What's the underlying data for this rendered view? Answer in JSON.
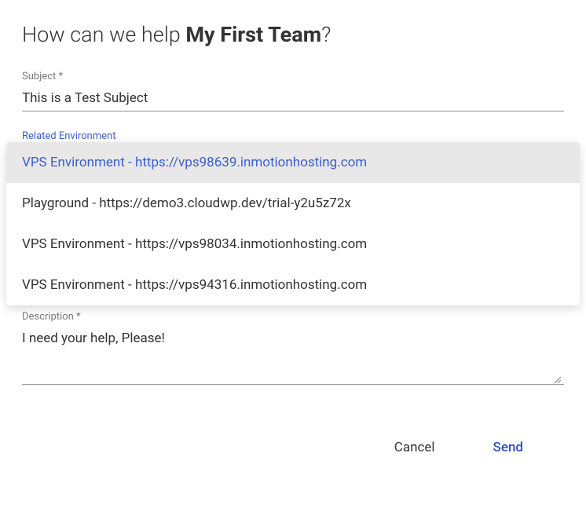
{
  "heading": {
    "prefix": "How can we help ",
    "team_name": "My First Team",
    "suffix": "?"
  },
  "subject": {
    "label": "Subject *",
    "value": "This is a Test Subject"
  },
  "environment": {
    "label": "Related Environment",
    "options": [
      "VPS Environment - https://vps98639.inmotionhosting.com",
      "Playground - https://demo3.cloudwp.dev/trial-y2u5z72x",
      "VPS Environment - https://vps98034.inmotionhosting.com",
      "VPS Environment - https://vps94316.inmotionhosting.com"
    ],
    "selected_index": 0
  },
  "description": {
    "label": "Description *",
    "value": "I need your help, Please!"
  },
  "actions": {
    "cancel": "Cancel",
    "send": "Send"
  }
}
